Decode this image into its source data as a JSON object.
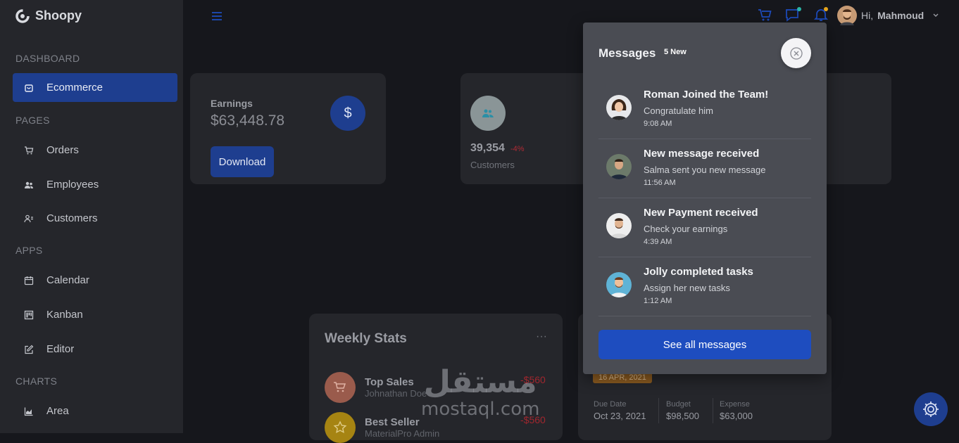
{
  "app": {
    "name": "Shoopy"
  },
  "sidebar": {
    "sections": [
      {
        "label": "DASHBOARD"
      },
      {
        "label": "PAGES"
      },
      {
        "label": "APPS"
      },
      {
        "label": "CHARTS"
      }
    ],
    "items": [
      {
        "label": "Ecommerce",
        "icon": "bag-icon",
        "active": true
      },
      {
        "label": "Orders",
        "icon": "cart-icon"
      },
      {
        "label": "Employees",
        "icon": "users-icon"
      },
      {
        "label": "Customers",
        "icon": "user-list-icon"
      },
      {
        "label": "Calendar",
        "icon": "calendar-icon"
      },
      {
        "label": "Kanban",
        "icon": "kanban-icon"
      },
      {
        "label": "Editor",
        "icon": "edit-icon"
      },
      {
        "label": "Area",
        "icon": "area-chart-icon"
      }
    ]
  },
  "header": {
    "greeting": "Hi,",
    "user_name": "Mahmoud"
  },
  "earnings": {
    "label": "Earnings",
    "value": "$63,448.78",
    "download_label": "Download",
    "currency_symbol": "$"
  },
  "customers": {
    "value": "39,354",
    "change": "-4%",
    "label": "Customers"
  },
  "weekly_stats": {
    "title": "Weekly Stats",
    "more": "···",
    "rows": [
      {
        "title": "Top Sales",
        "subtitle": "Johnathan Doe",
        "amount": "-$560"
      },
      {
        "title": "Best Seller",
        "subtitle": "MaterialPro Admin",
        "amount": "-$560"
      }
    ]
  },
  "project": {
    "date_badge": "16 APR, 2021",
    "due_label": "Due Date",
    "due_value": "Oct 23, 2021",
    "budget_label": "Budget",
    "budget_value": "$98,500",
    "expense_label": "Expense",
    "expense_value": "$63,000"
  },
  "messages_panel": {
    "title": "Messages",
    "badge": "5 New",
    "items": [
      {
        "title": "Roman Joined the Team!",
        "subtitle": "Congratulate him",
        "time": "9:08 AM"
      },
      {
        "title": "New message received",
        "subtitle": "Salma sent you new message",
        "time": "11:56 AM"
      },
      {
        "title": "New Payment received",
        "subtitle": "Check your earnings",
        "time": "4:39 AM"
      },
      {
        "title": "Jolly completed tasks",
        "subtitle": "Assign her new tasks",
        "time": "1:12 AM"
      }
    ],
    "see_all_label": "See all messages"
  },
  "watermark": {
    "arabic": "مستقل",
    "latin": "mostaql.com"
  },
  "colors": {
    "primary": "#1e3e8f",
    "panel_bg": "#4a4c53",
    "sidebar_bg": "#25262b",
    "page_bg": "#16171c",
    "negative": "#e0303d",
    "badge_orange": "#c6721e"
  }
}
